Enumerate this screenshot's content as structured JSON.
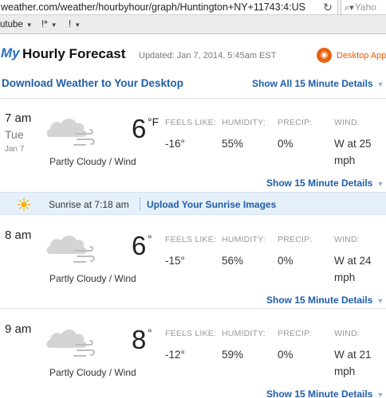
{
  "browser": {
    "url": "weather.com/weather/hourbyhour/graph/Huntington+NY+11743:4:US",
    "search_placeholder": "Yaho",
    "bookmarks": [
      "utube",
      "!*",
      "!"
    ]
  },
  "header": {
    "logo": "My",
    "title": "Hourly Forecast",
    "updated": "Updated: Jan 7, 2014, 5:45am EST",
    "desktop_app": "Desktop App"
  },
  "download_link": "Download Weather to Your Desktop",
  "show_all_link": "Show All 15 Minute Details",
  "labels": {
    "feels_like": "FEELS LIKE:",
    "humidity": "HUMIDITY:",
    "precip": "PRECIP:",
    "wind": "WIND:",
    "show15": "Show 15 Minute Details"
  },
  "hours": [
    {
      "time": "7 am",
      "day": "Tue",
      "date": "Jan 7",
      "temp": "6",
      "unit": "°F",
      "condition": "Partly Cloudy / Wind",
      "feels_like": "-16°",
      "humidity": "55%",
      "precip": "0%",
      "wind_line1": "W at 25",
      "wind_line2": "mph"
    },
    {
      "time": "8 am",
      "day": "",
      "date": "",
      "temp": "6",
      "unit": "°",
      "condition": "Partly Cloudy / Wind",
      "feels_like": "-15°",
      "humidity": "56%",
      "precip": "0%",
      "wind_line1": "W at 24",
      "wind_line2": "mph"
    },
    {
      "time": "9 am",
      "day": "",
      "date": "",
      "temp": "8",
      "unit": "°",
      "condition": "Partly Cloudy / Wind",
      "feels_like": "-12°",
      "humidity": "59%",
      "precip": "0%",
      "wind_line1": "W at 21",
      "wind_line2": "mph"
    }
  ],
  "sunrise": {
    "text": "Sunrise at 7:18 am",
    "upload_link": "Upload Your Sunrise Images"
  },
  "icons": {
    "weather": "partly-cloudy-wind-icon",
    "sun": "sun-icon",
    "reload": "reload-icon",
    "search": "search-icon",
    "desktop_app": "desktop-app-icon"
  },
  "colors": {
    "link": "#1f5ea8",
    "accent_orange": "#e35a0b",
    "sunrise_bar": "#e6f0fa"
  }
}
